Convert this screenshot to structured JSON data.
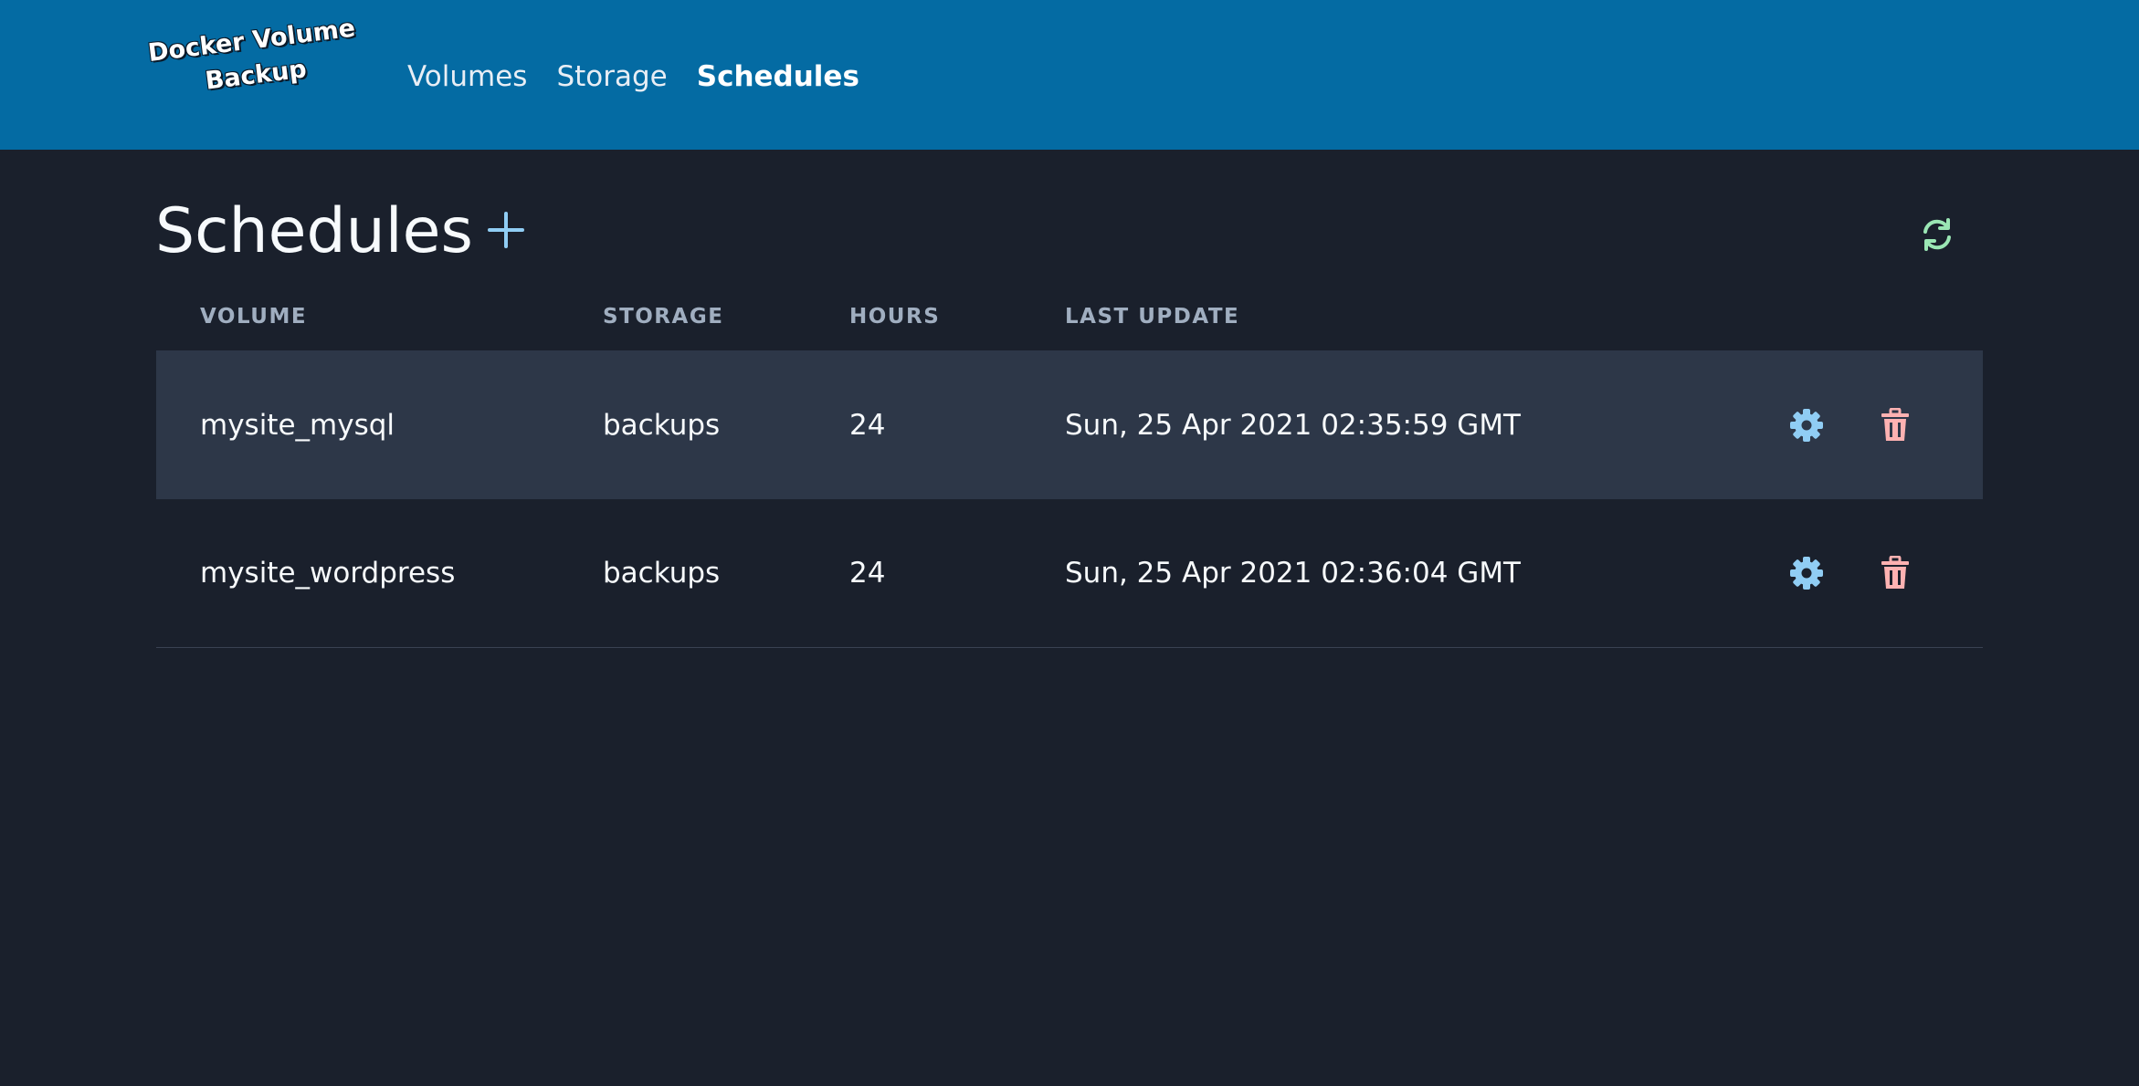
{
  "app": {
    "logo_line1": "Docker Volume",
    "logo_line2": "Backup"
  },
  "nav": {
    "items": [
      {
        "label": "Volumes",
        "active": false
      },
      {
        "label": "Storage",
        "active": false
      },
      {
        "label": "Schedules",
        "active": true
      }
    ]
  },
  "page": {
    "title": "Schedules",
    "add_icon": "plus-icon",
    "refresh_icon": "refresh-icon"
  },
  "table": {
    "headers": [
      "VOLUME",
      "STORAGE",
      "HOURS",
      "LAST UPDATE"
    ],
    "rows": [
      {
        "volume": "mysite_mysql",
        "storage": "backups",
        "hours": "24",
        "last_update": "Sun, 25 Apr 2021 02:35:59 GMT"
      },
      {
        "volume": "mysite_wordpress",
        "storage": "backups",
        "hours": "24",
        "last_update": "Sun, 25 Apr 2021 02:36:04 GMT"
      }
    ],
    "row_actions": [
      "gear-icon",
      "trash-icon"
    ]
  },
  "colors": {
    "navbar": "#046ba3",
    "background": "#1a202c",
    "row_highlight": "#2d3748",
    "accent_blue": "#90cdf4",
    "refresh_green": "#9ae6b4",
    "delete_red": "#feb2b2"
  }
}
